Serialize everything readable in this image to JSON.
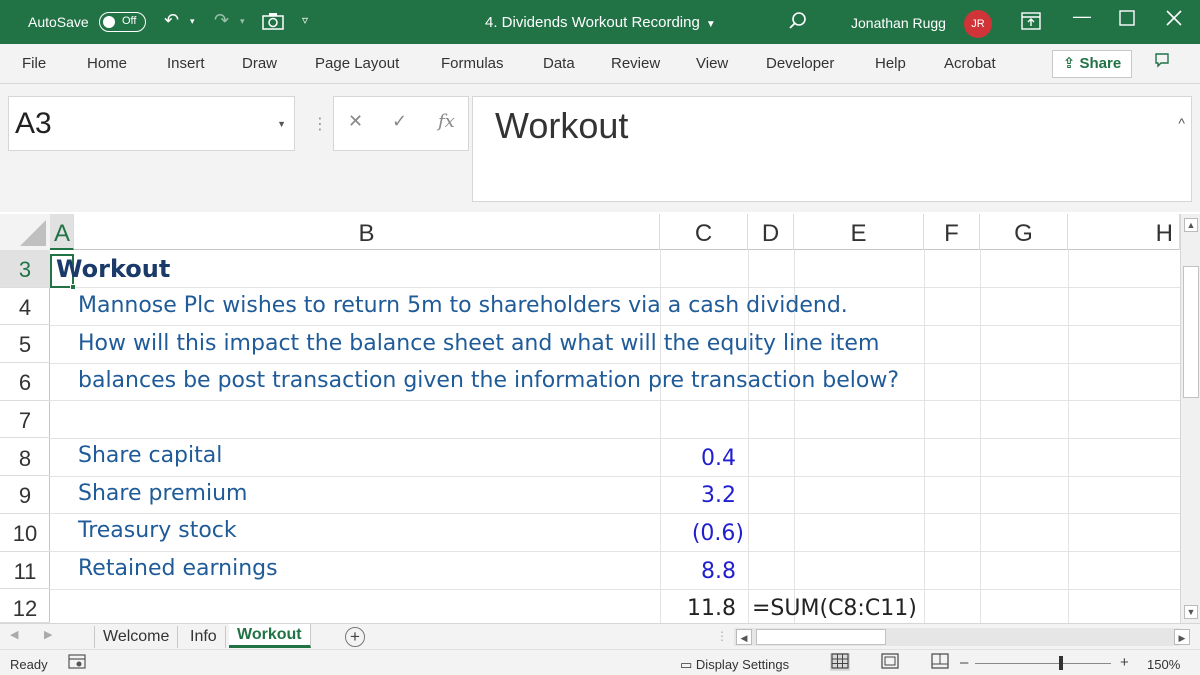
{
  "titlebar": {
    "autosave_label": "AutoSave",
    "autosave_state": "Off",
    "document_title": "4. Dividends Workout Recording",
    "user_name": "Jonathan Rugg",
    "user_initials": "JR"
  },
  "ribbon": {
    "tabs": [
      "File",
      "Home",
      "Insert",
      "Draw",
      "Page Layout",
      "Formulas",
      "Data",
      "Review",
      "View",
      "Developer",
      "Help",
      "Acrobat"
    ],
    "share_label": "Share"
  },
  "formula_bar": {
    "name_box": "A3",
    "fx_label": "fx",
    "content": "Workout"
  },
  "grid": {
    "columns": [
      "A",
      "B",
      "C",
      "D",
      "E",
      "F",
      "G",
      "H"
    ],
    "selected_column": "A",
    "rows": [
      "3",
      "4",
      "5",
      "6",
      "7",
      "8",
      "9",
      "10",
      "11",
      "12"
    ],
    "selected_row": "3",
    "title": "Workout",
    "question_lines": [
      "Mannose Plc wishes to return 5m to shareholders via a cash dividend.",
      "How will this impact the balance sheet and what will the equity line item",
      "balances be post transaction given the information pre transaction below?"
    ],
    "line_items": [
      {
        "label": "Share capital",
        "value": "0.4"
      },
      {
        "label": "Share premium",
        "value": "3.2"
      },
      {
        "label": "Treasury stock",
        "value": "(0.6)"
      },
      {
        "label": "Retained earnings",
        "value": "8.8"
      }
    ],
    "total_value": "11.8",
    "total_formula": "=SUM(C8:C11)"
  },
  "sheets": {
    "tabs": [
      "Welcome",
      "Info",
      "Workout"
    ],
    "active": "Workout"
  },
  "statusbar": {
    "mode": "Ready",
    "display_settings": "Display Settings",
    "zoom_level": "150%"
  },
  "colors": {
    "accent": "#217346",
    "text_blue": "#1f5b98",
    "input_blue": "#1f1fcf"
  }
}
